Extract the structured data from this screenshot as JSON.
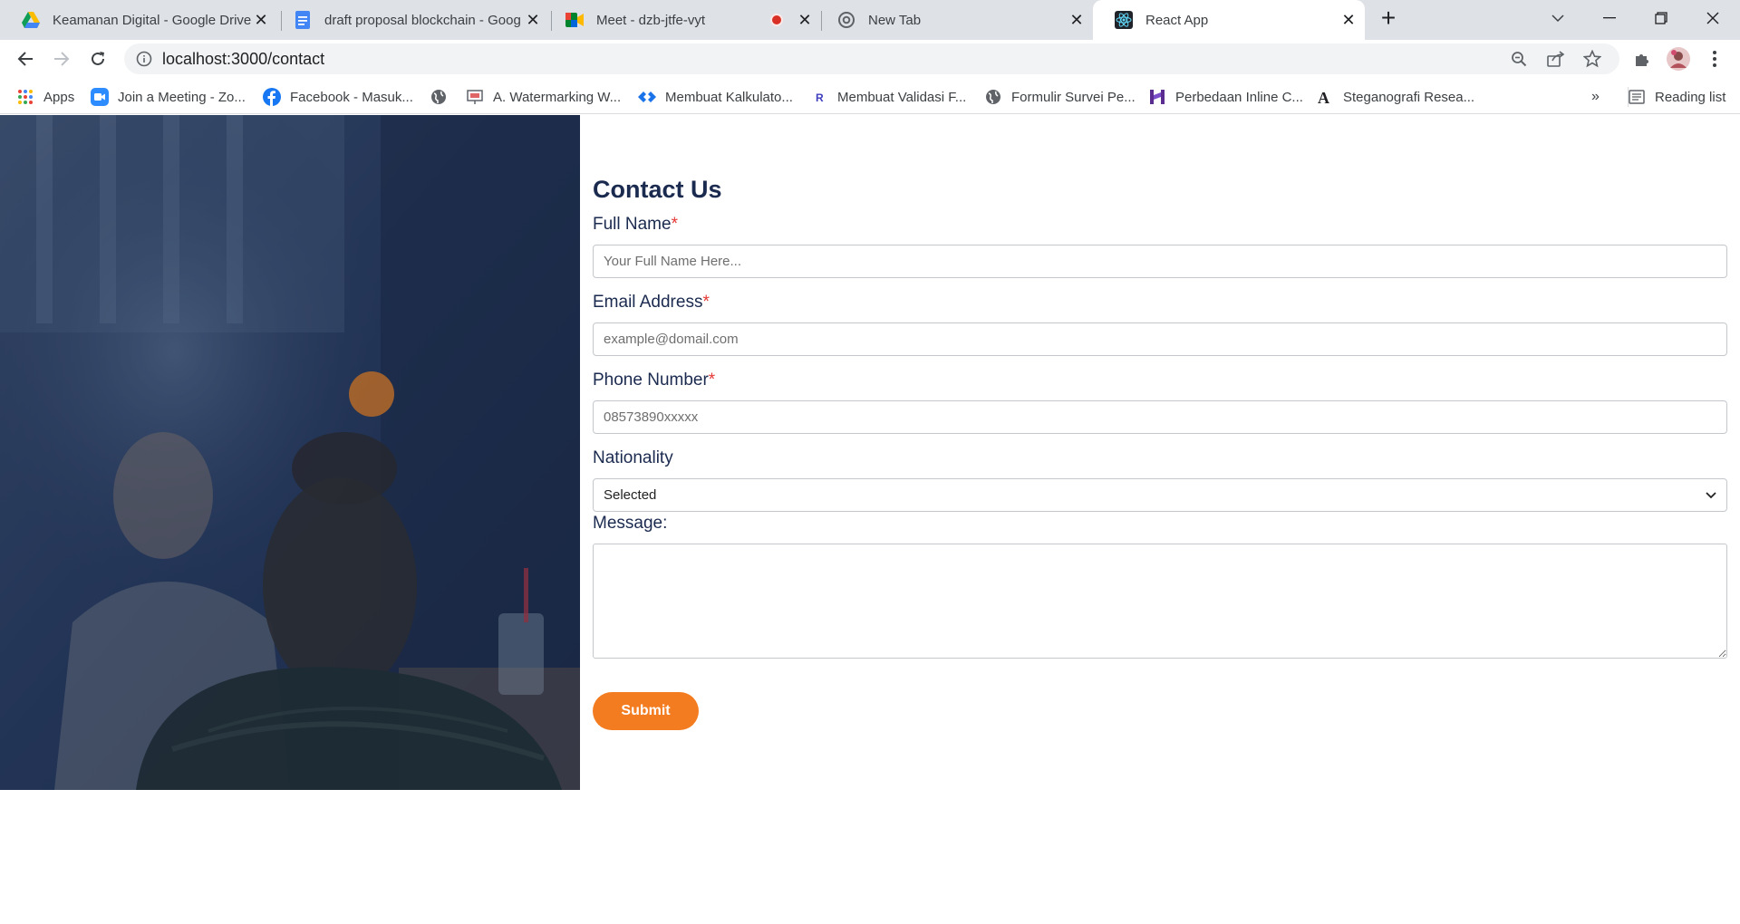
{
  "browser": {
    "tabs": [
      {
        "title": "Keamanan Digital - Google Drive",
        "icon": "google-drive-icon"
      },
      {
        "title": "draft proposal blockchain - Goog",
        "icon": "google-docs-icon"
      },
      {
        "title": "Meet - dzb-jtfe-vyt",
        "icon": "google-meet-icon"
      },
      {
        "title": "New Tab",
        "icon": "chrome-icon"
      },
      {
        "title": "React App",
        "icon": "react-icon"
      }
    ],
    "address": "localhost:3000/contact",
    "bookmarks": [
      {
        "label": "Apps",
        "icon": "apps-grid-icon"
      },
      {
        "label": "Join a Meeting - Zo...",
        "icon": "zoom-icon"
      },
      {
        "label": "Facebook - Masuk...",
        "icon": "facebook-icon"
      },
      {
        "label": "",
        "icon": "globe-icon"
      },
      {
        "label": "A. Watermarking W...",
        "icon": "slides-icon"
      },
      {
        "label": "Membuat Kalkulato...",
        "icon": "diamond-arrows-icon"
      },
      {
        "label": "Membuat Validasi F...",
        "icon": "bookmark-icon"
      },
      {
        "label": "Formulir Survei Pe...",
        "icon": "globe-icon"
      },
      {
        "label": "Perbedaan Inline C...",
        "icon": "h-logo-icon"
      },
      {
        "label": "Steganografi Resea...",
        "icon": "letter-a-icon"
      }
    ],
    "reading_list": "Reading list",
    "colors": {
      "tabbar": "#dee1e6",
      "omnibox": "#f1f3f4"
    }
  },
  "page": {
    "title": "Contact Us",
    "full_name": {
      "label": "Full Name",
      "placeholder": "Your Full Name Here..."
    },
    "email": {
      "label": "Email Address",
      "placeholder": "example@domail.com"
    },
    "phone": {
      "label": "Phone Number",
      "placeholder": "08573890xxxxx"
    },
    "nationality": {
      "label": "Nationality",
      "selected": "Selected"
    },
    "message": {
      "label": "Message:"
    },
    "required_mark": "*",
    "submit": "Submit",
    "colors": {
      "accent": "#f47c20",
      "heading": "#1b2a4f",
      "required": "#e53935",
      "hero_overlay": "#1d2e4d"
    }
  }
}
